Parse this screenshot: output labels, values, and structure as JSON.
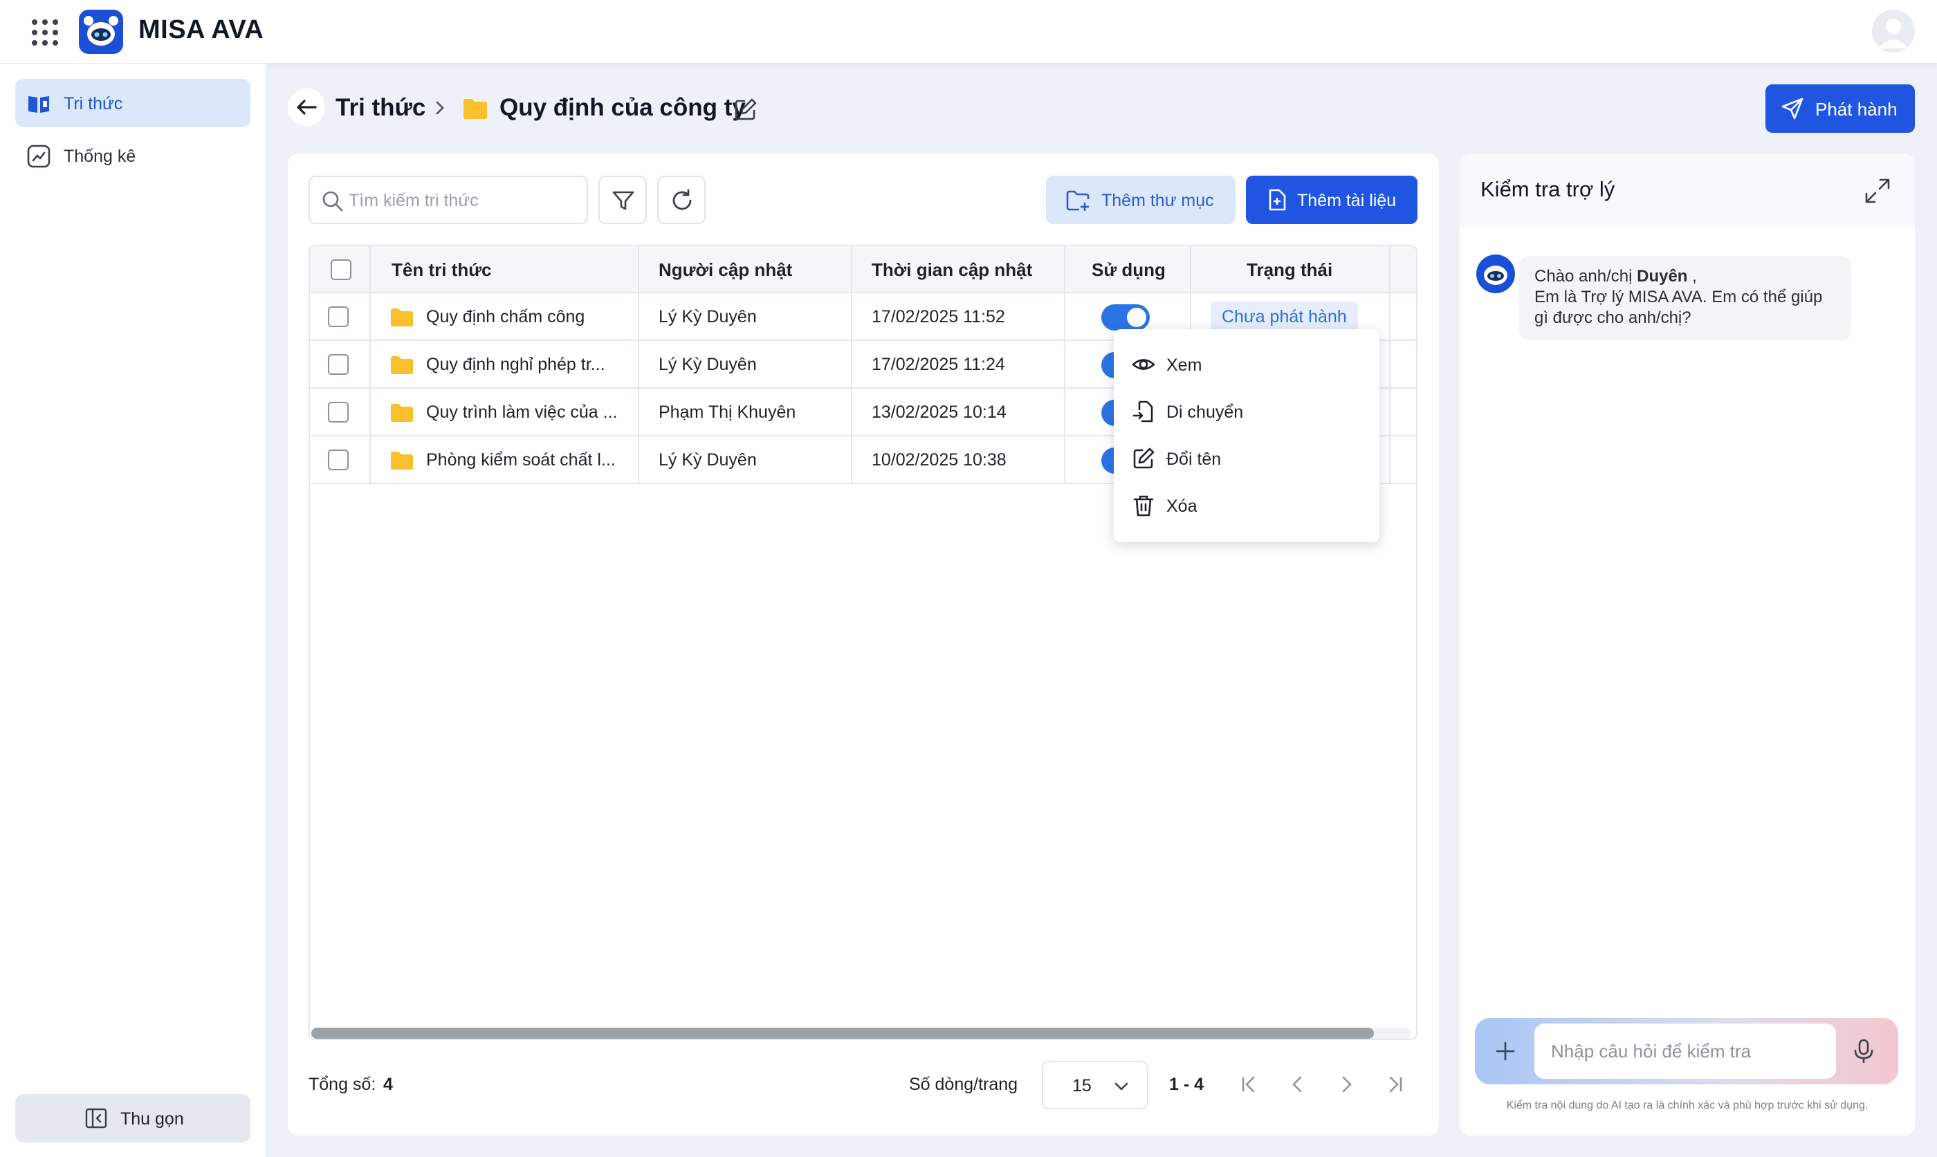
{
  "app": {
    "title": "MISA AVA"
  },
  "sidebar": {
    "items": [
      {
        "label": "Tri thức",
        "icon": "book-icon",
        "active": true
      },
      {
        "label": "Thống kê",
        "icon": "chart-icon",
        "active": false
      }
    ],
    "collapse_label": "Thu gọn"
  },
  "header": {
    "breadcrumb_root": "Tri thức",
    "current_folder": "Quy định của công ty",
    "publish_label": "Phát hành"
  },
  "toolbar": {
    "search_placeholder": "Tìm kiếm tri thức",
    "add_folder_label": "Thêm thư mục",
    "add_document_label": "Thêm tài liệu"
  },
  "table": {
    "columns": [
      "Tên tri thức",
      "Người cập nhật",
      "Thời gian cập nhật",
      "Sử dụng",
      "Trạng thái"
    ],
    "rows": [
      {
        "name": "Quy định chấm công",
        "updater": "Lý Kỳ Duyên",
        "updated_at": "17/02/2025 11:52",
        "enabled": true,
        "status": "Chưa phát hành"
      },
      {
        "name": "Quy định nghỉ phép tr...",
        "updater": "Lý Kỳ Duyên",
        "updated_at": "17/02/2025 11:24",
        "enabled": true,
        "status": ""
      },
      {
        "name": "Quy trình làm việc của ...",
        "updater": "Phạm Thị Khuyên",
        "updated_at": "13/02/2025 10:14",
        "enabled": true,
        "status": ""
      },
      {
        "name": "Phòng kiểm soát chất l...",
        "updater": "Lý Kỳ Duyên",
        "updated_at": "10/02/2025 10:38",
        "enabled": true,
        "status": ""
      }
    ]
  },
  "context_menu": {
    "items": [
      {
        "label": "Xem",
        "icon": "eye-icon"
      },
      {
        "label": "Di chuyển",
        "icon": "move-file-icon"
      },
      {
        "label": "Đổi tên",
        "icon": "edit-icon"
      },
      {
        "label": "Xóa",
        "icon": "trash-icon"
      }
    ]
  },
  "pagination": {
    "total_label": "Tổng số:",
    "total_value": "4",
    "rows_per_page_label": "Số dòng/trang",
    "rows_per_page_value": "15",
    "range": "1 - 4"
  },
  "assistant": {
    "title": "Kiểm tra trợ lý",
    "greeting_prefix": "Chào anh/chị ",
    "greeting_name": "Duyên",
    "greeting_suffix": " ,",
    "greeting_line2": "Em là Trợ lý MISA AVA. Em có thể giúp",
    "greeting_line3": "gì được cho anh/chị?",
    "input_placeholder": "Nhập câu hỏi để kiểm tra",
    "disclaimer": "Kiểm tra nội dung do AI tạo ra là chính xác và phù hợp trước khi sử dụng."
  },
  "colors": {
    "primary": "#1f55e0",
    "active_nav_bg": "#dbe7fb",
    "folder": "#f8c12c",
    "toggle_on": "#2b74e6",
    "status_text": "#2d6fe0"
  }
}
